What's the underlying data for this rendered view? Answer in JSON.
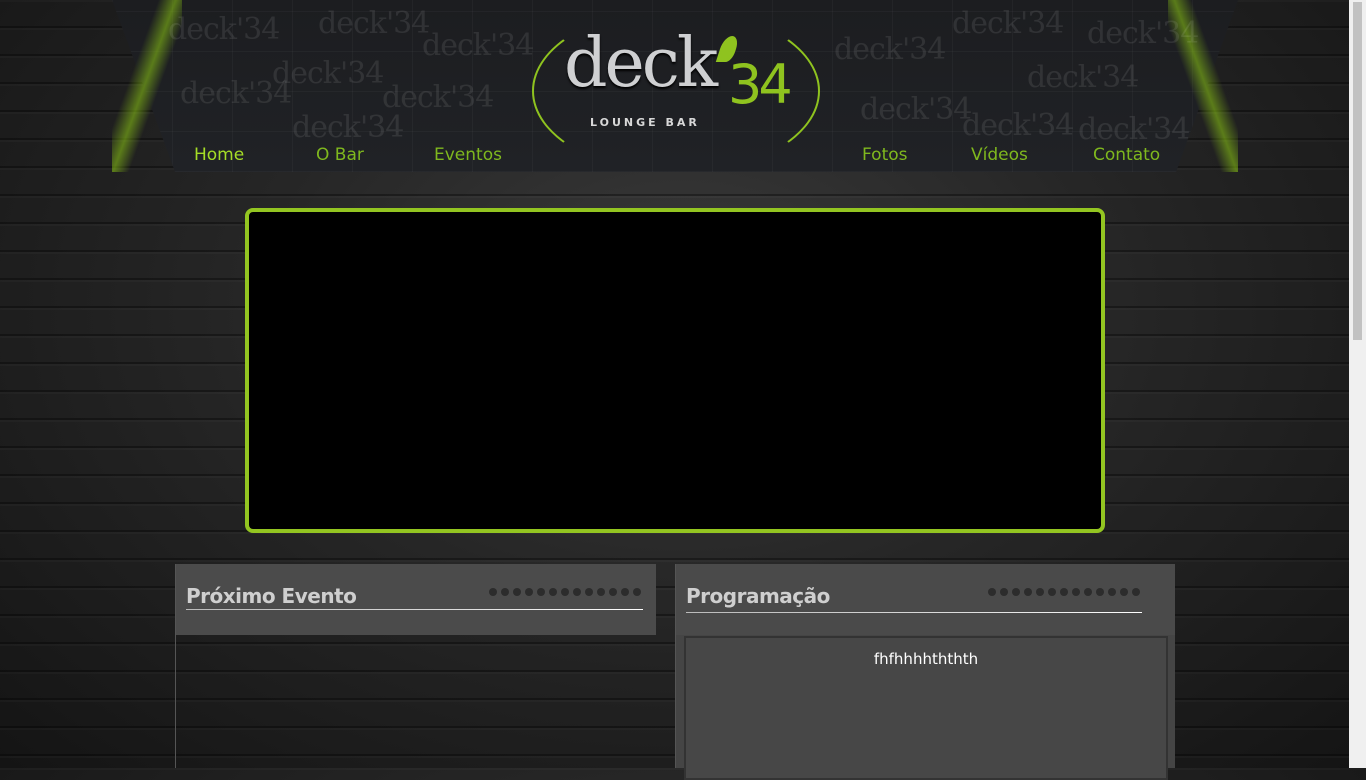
{
  "header": {
    "logo": {
      "word": "deck",
      "number": "34",
      "tagline": "LOUNGE BAR"
    },
    "nav": [
      {
        "label": "Home",
        "active": true
      },
      {
        "label": "O Bar",
        "active": false
      },
      {
        "label": "Eventos",
        "active": false
      },
      {
        "label": "Fotos",
        "active": false
      },
      {
        "label": "Vídeos",
        "active": false
      },
      {
        "label": "Contato",
        "active": false
      }
    ]
  },
  "panels": {
    "next_event": {
      "title": "Próximo Evento"
    },
    "schedule": {
      "title": "Programação",
      "text": "fhfhhhhththth"
    }
  },
  "colors": {
    "accent": "#93c521",
    "nav_text": "#7fb81e",
    "nav_active": "#a5dd26",
    "panel_bg": "#4a4a4a",
    "banner_bg": "#000000"
  }
}
